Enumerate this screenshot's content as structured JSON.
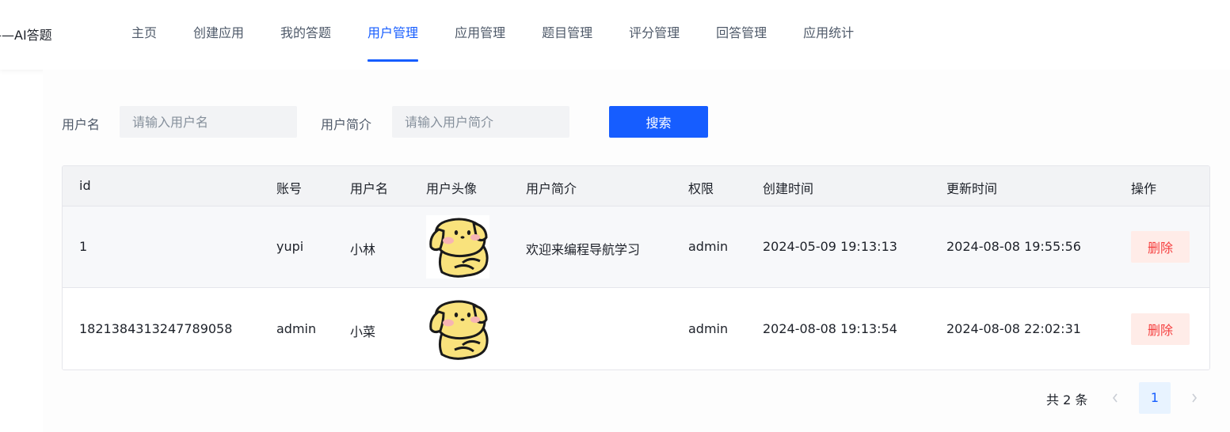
{
  "header": {
    "brand": "——AI答题",
    "nav": [
      {
        "label": "主页",
        "active": false
      },
      {
        "label": "创建应用",
        "active": false
      },
      {
        "label": "我的答题",
        "active": false
      },
      {
        "label": "用户管理",
        "active": true
      },
      {
        "label": "应用管理",
        "active": false
      },
      {
        "label": "题目管理",
        "active": false
      },
      {
        "label": "评分管理",
        "active": false
      },
      {
        "label": "回答管理",
        "active": false
      },
      {
        "label": "应用统计",
        "active": false
      }
    ]
  },
  "search": {
    "username_label": "用户名",
    "username_placeholder": "请输入用户名",
    "username_value": "",
    "profile_label": "用户简介",
    "profile_placeholder": "请输入用户简介",
    "profile_value": "",
    "button_label": "搜索"
  },
  "table": {
    "columns": [
      "id",
      "账号",
      "用户名",
      "用户头像",
      "用户简介",
      "权限",
      "创建时间",
      "更新时间",
      "操作"
    ],
    "rows": [
      {
        "id": "1",
        "account": "yupi",
        "username": "小林",
        "avatar_icon": "yellow-puppy-avatar",
        "profile": "欢迎来编程导航学习",
        "role": "admin",
        "created": "2024-05-09 19:13:13",
        "updated": "2024-08-08 19:55:56",
        "action": "删除"
      },
      {
        "id": "1821384313247789058",
        "account": "admin",
        "username": "小菜",
        "avatar_icon": "yellow-puppy-avatar",
        "profile": "",
        "role": "admin",
        "created": "2024-08-08 19:13:54",
        "updated": "2024-08-08 22:02:31",
        "action": "删除"
      }
    ]
  },
  "pagination": {
    "total_text": "共 2 条",
    "current_page": "1",
    "prev_icon": "chevron-left-icon",
    "next_icon": "chevron-right-icon"
  },
  "colors": {
    "primary": "#165dff",
    "danger": "#f53f3f",
    "danger_bg": "#ffece8",
    "avatar_yellow": "#f9e27c"
  }
}
